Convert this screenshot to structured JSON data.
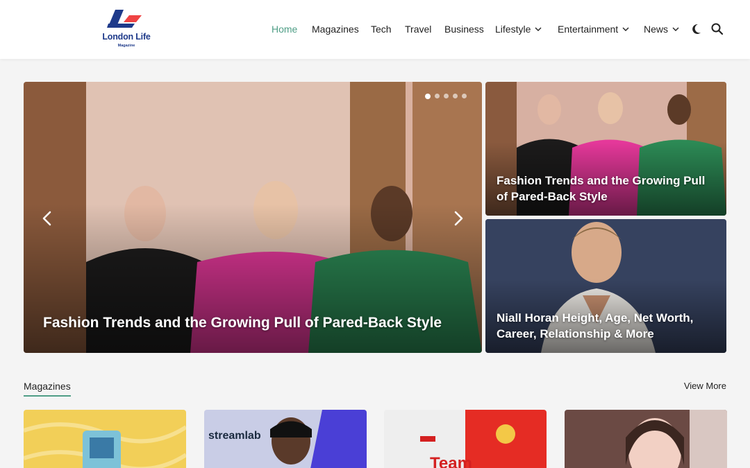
{
  "brand": {
    "name": "London Life",
    "tagline": "Magazine",
    "colors": {
      "blue": "#1e3a8a",
      "red": "#ef4444",
      "accent": "#4f9e86"
    }
  },
  "nav": {
    "items": [
      {
        "label": "Home",
        "active": true
      },
      {
        "label": "Magazines"
      },
      {
        "label": "Tech"
      },
      {
        "label": "Travel"
      },
      {
        "label": "Business"
      },
      {
        "label": "Lifestyle",
        "dropdown": true
      },
      {
        "label": "Entertainment",
        "dropdown": true
      },
      {
        "label": "News",
        "dropdown": true
      }
    ],
    "icons": [
      "dark-mode-icon",
      "search-icon"
    ]
  },
  "hero": {
    "title": "Fashion Trends and the Growing Pull of Pared-Back Style",
    "slides": 5,
    "active_slide": 1
  },
  "side_cards": [
    {
      "title": "Fashion Trends and the Growing Pull of Pared-Back Style"
    },
    {
      "title": "Niall Horan Height, Age, Net Worth, Career, Relationship & More"
    }
  ],
  "section": {
    "title": "Magazines",
    "view_more": "View More"
  },
  "thumbnails": {
    "thumb2_text": "streamlab",
    "thumb3_text": "Team"
  }
}
